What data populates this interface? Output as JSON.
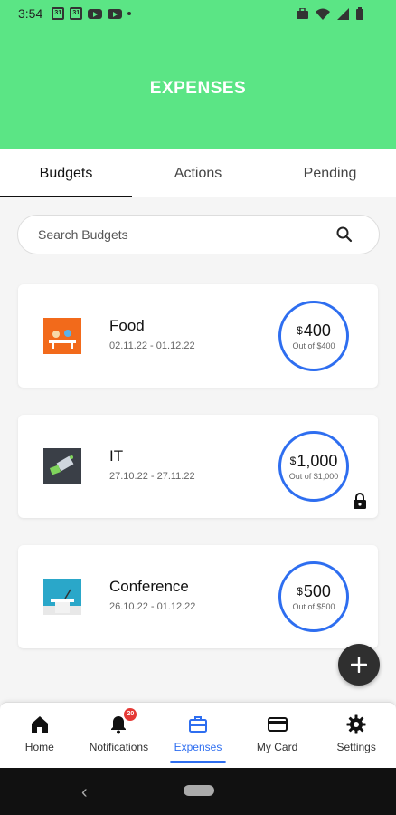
{
  "status_bar": {
    "time": "3:54",
    "calendar_day": "31",
    "icons": [
      "calendar-icon",
      "calendar-icon",
      "youtube-icon",
      "youtube-icon",
      "dot-icon",
      "briefcase-icon",
      "wifi-icon",
      "signal-icon",
      "battery-icon"
    ]
  },
  "header": {
    "title": "EXPENSES"
  },
  "tabs": [
    {
      "label": "Budgets",
      "active": true
    },
    {
      "label": "Actions",
      "active": false
    },
    {
      "label": "Pending",
      "active": false
    }
  ],
  "search": {
    "placeholder": "Search Budgets"
  },
  "budgets": [
    {
      "name": "Food",
      "dates": "02.11.22 - 01.12.22",
      "currency": "$",
      "amount": "400",
      "out_of": "Out of $400",
      "locked": false
    },
    {
      "name": "IT",
      "dates": "27.10.22 - 27.11.22",
      "currency": "$",
      "amount": "1,000",
      "out_of": "Out of $1,000",
      "locked": true
    },
    {
      "name": "Conference",
      "dates": "26.10.22 - 01.12.22",
      "currency": "$",
      "amount": "500",
      "out_of": "Out of $500",
      "locked": false
    }
  ],
  "fab": {
    "icon": "plus-icon"
  },
  "bottom_nav": [
    {
      "label": "Home",
      "icon": "home-icon",
      "active": false
    },
    {
      "label": "Notifications",
      "icon": "bell-icon",
      "active": false,
      "badge": "20"
    },
    {
      "label": "Expenses",
      "icon": "briefcase-icon",
      "active": true
    },
    {
      "label": "My Card",
      "icon": "credit-card-icon",
      "active": false
    },
    {
      "label": "Settings",
      "icon": "gear-icon",
      "active": false
    }
  ],
  "colors": {
    "accent_green": "#5be585",
    "ring_blue": "#2e6ef0",
    "fab": "#2f2f2f"
  }
}
